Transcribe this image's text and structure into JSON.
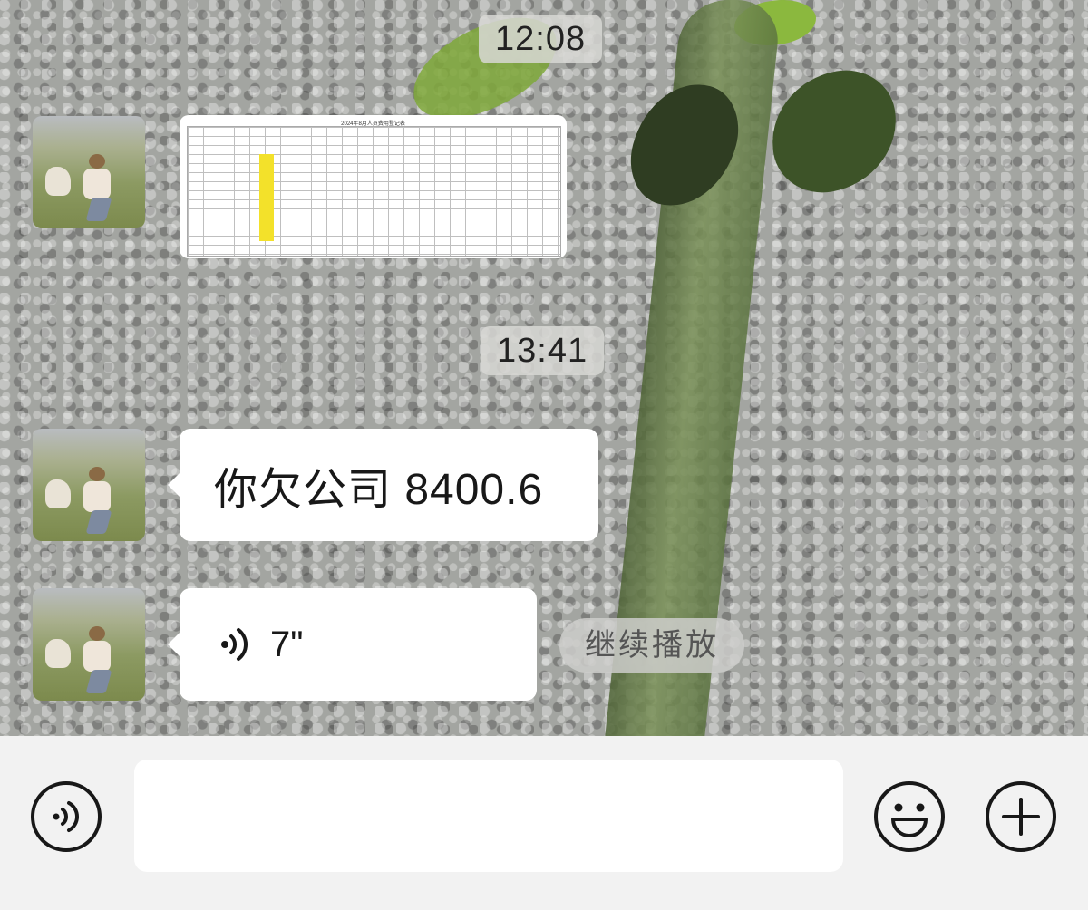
{
  "conversation": {
    "timestamps": [
      "12:08",
      "13:41"
    ],
    "messages": {
      "text": "你欠公司 8400.6",
      "voice_duration": "7\"",
      "voice_action": "继续播放"
    },
    "image_message": {
      "sheet_title": "2024年8月人员费用登记表"
    }
  },
  "input_bar": {
    "voice_button": "voice-mode-icon",
    "emoji_button": "emoji-icon",
    "more_button": "plus-icon",
    "input_value": ""
  }
}
